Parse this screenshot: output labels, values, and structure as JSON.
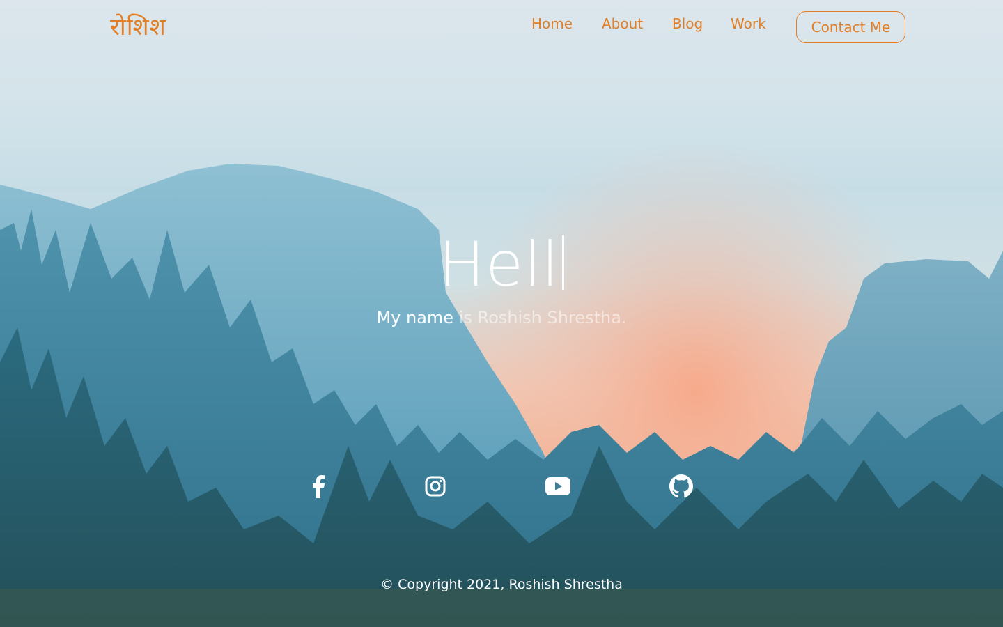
{
  "nav": {
    "logo": "रोशिश",
    "links": [
      {
        "label": "Home"
      },
      {
        "label": "About"
      },
      {
        "label": "Blog"
      },
      {
        "label": "Work"
      }
    ],
    "contact_label": "Contact Me"
  },
  "hero": {
    "title": "Hell",
    "subtitle_bright": "My name",
    "subtitle_dim": " is Roshish Shrestha."
  },
  "social": [
    {
      "icon": "facebook-icon"
    },
    {
      "icon": "instagram-icon"
    },
    {
      "icon": "youtube-icon"
    },
    {
      "icon": "github-icon"
    }
  ],
  "footer": {
    "copyright": "© Copyright 2021, Roshish Shrestha"
  },
  "colors": {
    "accent": "#e07f27",
    "text_light": "#ffffff"
  }
}
